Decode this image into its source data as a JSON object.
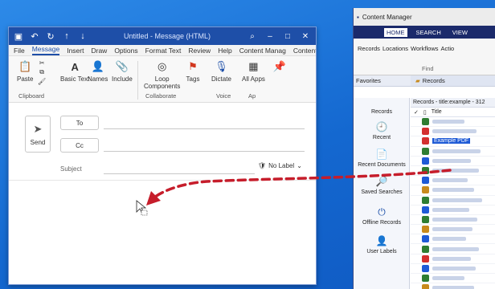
{
  "outlook": {
    "title": "Untitled - Message (HTML)",
    "tabs": [
      "File",
      "Message",
      "Insert",
      "Draw",
      "Options",
      "Format Text",
      "Review",
      "Help",
      "Content Manag",
      "Content Manag"
    ],
    "active_tab": "Message",
    "ribbon": {
      "paste": "Paste",
      "basic_text": "Basic Text",
      "names": "Names",
      "include": "Include",
      "loop": "Loop",
      "loop_components": "Components",
      "tags": "Tags",
      "dictate": "Dictate",
      "all_apps": "All Apps",
      "groups": {
        "clipboard": "Clipboard",
        "collaborate": "Collaborate",
        "voice": "Voice",
        "apps": "Ap"
      }
    },
    "compose": {
      "send": "Send",
      "to": "To",
      "cc": "Cc",
      "subject": "Subject",
      "label": "No Label"
    }
  },
  "content_manager": {
    "title": "Content Manager",
    "ribbon_tabs": [
      "HOME",
      "SEARCH",
      "VIEW"
    ],
    "active_tab": "HOME",
    "ribbon_row": [
      "Records",
      "Locations",
      "Workflows",
      "Actio"
    ],
    "find": "Find",
    "favorites_header": "Favorites",
    "records_header": "Records",
    "favorites": [
      "Records",
      "Recent",
      "Recent Documents",
      "Saved Searches",
      "Offline Records",
      "User Labels"
    ],
    "path": "Records - title:example - 312",
    "column_title": "Title",
    "highlighted_title": "Example PDF"
  },
  "colors": {
    "outlook_blue": "#1e4fa8",
    "cm_navy": "#1b2a6b",
    "arrow_red": "#c61d2b"
  }
}
